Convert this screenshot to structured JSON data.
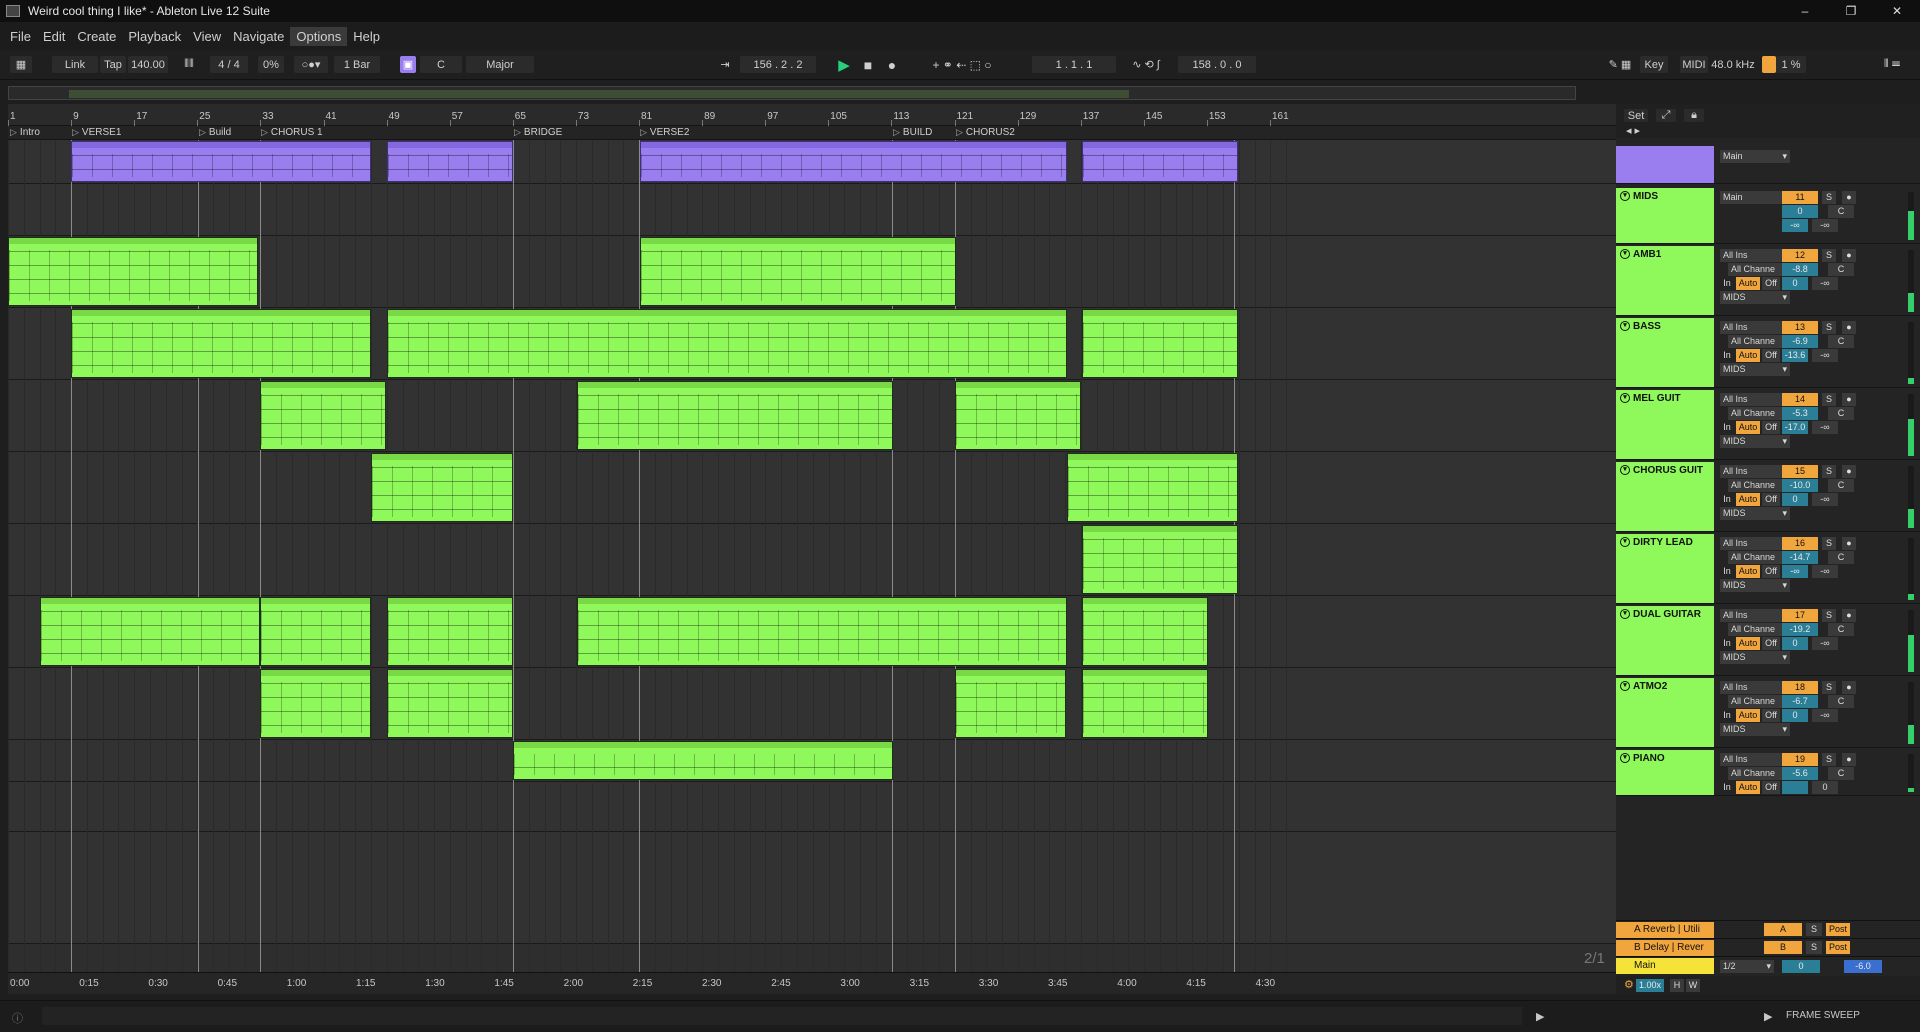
{
  "window": {
    "title": "Weird cool thing I like* - Ableton Live 12 Suite",
    "buttons": [
      "–",
      "❐",
      "✕"
    ]
  },
  "menu": [
    "File",
    "Edit",
    "Create",
    "Playback",
    "View",
    "Navigate",
    "Options",
    "Help"
  ],
  "menu_active": "Options",
  "control_bar": {
    "link": "Link",
    "tap": "Tap",
    "tempo": "140.00",
    "signature": "4 / 4",
    "groove": "0%",
    "quantize": "1 Bar",
    "key": "C",
    "scale": "Major",
    "position": "156 .  2 .  2",
    "loop_start": "1 .  1 .  1",
    "loop_length": "158 .  0 .  0",
    "key_map": "Key",
    "midi_map": "MIDI",
    "sample_rate": "48.0 kHz",
    "cpu": "1 %"
  },
  "ruler_bars": [
    "1",
    "9",
    "17",
    "25",
    "33",
    "41",
    "49",
    "57",
    "65",
    "73",
    "81",
    "89",
    "97",
    "105",
    "113",
    "121",
    "129",
    "137",
    "145",
    "153",
    "161"
  ],
  "locators": [
    "Intro",
    "VERSE1",
    "Build",
    "CHORUS 1",
    "BRIDGE",
    "VERSE2",
    "BUILD",
    "CHORUS2"
  ],
  "time_markers": [
    "0:00",
    "0:15",
    "0:30",
    "0:45",
    "1:00",
    "1:15",
    "1:30",
    "1:45",
    "2:00",
    "2:15",
    "2:30",
    "2:45",
    "3:00",
    "3:15",
    "3:30",
    "3:45",
    "4:00",
    "4:15",
    "4:30"
  ],
  "tracks": [
    {
      "name": "MIDS",
      "icon": "folder-icon",
      "input": "Main",
      "num": "11",
      "vol": "0",
      "pan": "C",
      "send_a": "-∞",
      "send_b": "-∞"
    },
    {
      "name": "AMB1",
      "icon": "fold-icon",
      "input": "All Ins",
      "chan": "All Channe",
      "num": "12",
      "vol": "-8.8",
      "pan": "C",
      "send_a": "0",
      "send_b": "-∞",
      "out": "MIDS"
    },
    {
      "name": "BASS",
      "icon": "fold-icon",
      "input": "All Ins",
      "chan": "All Channe",
      "num": "13",
      "vol": "-6.9",
      "pan": "C",
      "send_a": "-13.6",
      "send_b": "-∞",
      "out": "MIDS"
    },
    {
      "name": "MEL GUIT",
      "icon": "fold-icon",
      "input": "All Ins",
      "chan": "All Channe",
      "num": "14",
      "vol": "-5.3",
      "pan": "C",
      "send_a": "-17.0",
      "send_b": "-∞",
      "out": "MIDS"
    },
    {
      "name": "CHORUS GUIT",
      "icon": "fold-icon",
      "input": "All Ins",
      "chan": "All Channe",
      "num": "15",
      "vol": "-10.0",
      "pan": "C",
      "send_a": "0",
      "send_b": "-∞",
      "out": "MIDS"
    },
    {
      "name": "DIRTY LEAD",
      "icon": "fold-icon",
      "input": "All Ins",
      "chan": "All Channe",
      "num": "16",
      "vol": "-14.7",
      "pan": "C",
      "send_a": "-∞",
      "send_b": "-∞",
      "out": "MIDS"
    },
    {
      "name": "DUAL GUITAR",
      "icon": "fold-icon",
      "input": "All Ins",
      "chan": "All Channe",
      "num": "17",
      "vol": "-19.2",
      "pan": "C",
      "send_a": "0",
      "send_b": "-∞",
      "out": "MIDS"
    },
    {
      "name": "ATMO2",
      "icon": "fold-icon",
      "input": "All Ins",
      "chan": "All Channe",
      "num": "18",
      "vol": "-6.7",
      "pan": "C",
      "send_a": "0",
      "send_b": "-∞",
      "out": "MIDS"
    },
    {
      "name": "PIANO",
      "icon": "fold-icon",
      "input": "All Ins",
      "chan": "All Channe",
      "num": "19",
      "vol": "-5.6",
      "pan": "C",
      "send_a": "",
      "send_b": "0",
      "out": ""
    }
  ],
  "monitor": {
    "in": "In",
    "auto": "Auto",
    "off": "Off"
  },
  "returns": [
    {
      "name": "A Reverb | Utili",
      "label": "A",
      "solo": "S",
      "post": "Post"
    },
    {
      "name": "B Delay | Rever",
      "label": "B",
      "solo": "S",
      "post": "Post"
    }
  ],
  "main": {
    "name": "Main",
    "out": "1/2",
    "vol": "0",
    "pan": "-6.0"
  },
  "mixer_header": {
    "set": "Set"
  },
  "first_track_output": "Main",
  "zoom": "1.00x",
  "h": "H",
  "w": "W",
  "fraction": "2/1",
  "status": {
    "frame": "FRAME SWEEP"
  }
}
